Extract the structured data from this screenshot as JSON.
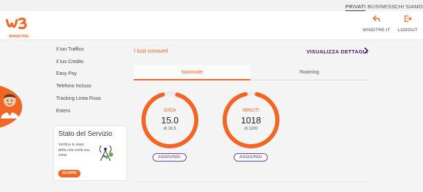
{
  "topnav": {
    "privati": "PRIVATI",
    "business": "BUSINESS",
    "chi_siamo": "CHI SIAMO"
  },
  "header": {
    "brand": "WINDTRE",
    "windtre_it": "WINDTRE.IT",
    "logout": "LOGOUT"
  },
  "menu": {
    "items": [
      "Il tuo Traffico",
      "Il tuo Credito",
      "Easy Pay",
      "Telefono Incluso",
      "Tracking Linea Fissa",
      "Estero"
    ]
  },
  "service": {
    "title": "Stato del Servizio",
    "text": "Verifica lo stato della rete nella tua zona",
    "button": "SCOPRI"
  },
  "consumi": {
    "title": "I tuoi consumi",
    "details": "VISUALIZZA DETTAGLI",
    "tabs": [
      "Nazionale",
      "Roaming"
    ],
    "gauges": [
      {
        "label": "GIGA",
        "value": "15.0",
        "sub": "di 16.5",
        "fraction": 0.91,
        "add": "AGGIUNGI"
      },
      {
        "label": "MINUTI",
        "value": "1018",
        "sub": "di 1100",
        "fraction": 0.93,
        "add": "AGGIUNGI"
      }
    ]
  },
  "colors": {
    "accent": "#f26522",
    "purple": "#4a1a7a"
  }
}
